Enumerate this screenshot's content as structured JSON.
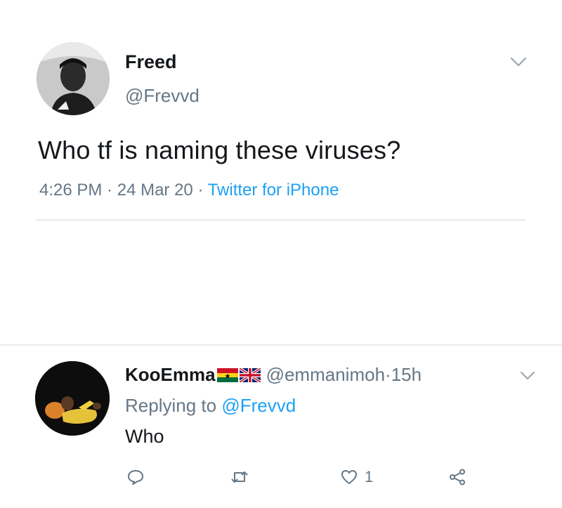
{
  "tweet": {
    "author_name": "Freed",
    "author_handle": "@Frevvd",
    "text": "Who tf is naming these viruses?",
    "time": "4:26 PM",
    "sep1": " · ",
    "date": "24 Mar 20",
    "sep2": " · ",
    "source": "Twitter for iPhone",
    "menu_icon": "chevron-down-icon"
  },
  "reply": {
    "author_name": "KooEmma",
    "flags": [
      "ghana-flag",
      "uk-flag"
    ],
    "author_handle": "@emmanimoh",
    "time_separator": " · ",
    "time_ago": "15h",
    "replying_prefix": "Replying to ",
    "replying_to": "@Frevvd",
    "text": "Who",
    "menu_icon": "chevron-down-icon",
    "actions": {
      "reply_icon": "reply-icon",
      "retweet_icon": "retweet-icon",
      "like_icon": "heart-icon",
      "like_count": "1",
      "share_icon": "share-icon"
    }
  },
  "colors": {
    "text": "#14171a",
    "secondary": "#657786",
    "link": "#1da1f2",
    "divider": "#e6ecf0"
  }
}
